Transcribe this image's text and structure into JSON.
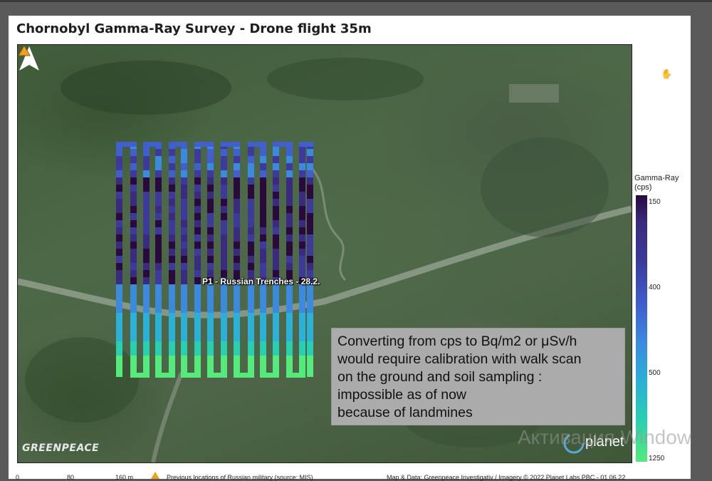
{
  "title": "Chornobyl Gamma-Ray Survey - Drone flight 35m",
  "poi": {
    "label": "P1  - Russian Trenches - 28.2."
  },
  "note_lines": [
    "Converting from cps to Bq/m2 or μSv/h",
    "would require calibration with walk scan",
    "on the ground and soil sampling :",
    "impossible as of now",
    "because of landmines"
  ],
  "legend": {
    "title_line1": "Gamma-Ray",
    "title_line2": "(cps)",
    "ticks": [
      "150",
      "400",
      "500",
      "1250"
    ]
  },
  "logos": {
    "greenpeace": "GREENPEACE",
    "planet": "planet"
  },
  "watermark": "Активация Window",
  "footer": {
    "scale": [
      "0",
      "80",
      "160 m"
    ],
    "legend_item": "Previous locations of Russian military (source: MIS)",
    "credits": "Map & Data: Greenpeace Investigativ / Imagery © 2022 Planet Labs PBC - 01.06.22"
  },
  "colors": {
    "marker": "#f0a020",
    "note_bg": "#ababab",
    "flight_low": "#55ea7c",
    "flight_high": "#2a0a3c"
  },
  "icons": [
    "north-arrow-icon",
    "pan-hand-icon",
    "triangle-marker-icon"
  ]
}
